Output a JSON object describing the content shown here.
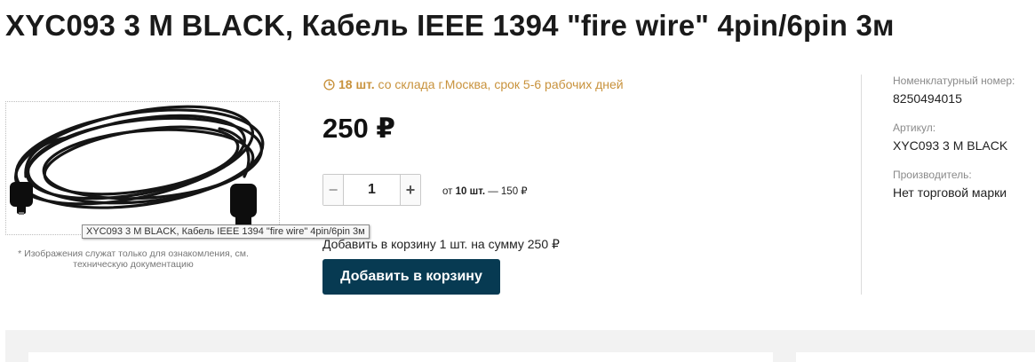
{
  "product": {
    "title": "XYC093 3 M BLACK, Кабель IEEE 1394 \"fire wire\" 4pin/6pin 3м",
    "image_tooltip": "XYC093 3 M BLACK, Кабель IEEE 1394 \"fire wire\" 4pin/6pin 3м",
    "image_note": "* Изображения служат только для ознакомления, см. техническую документацию"
  },
  "stock": {
    "icon": "clock-icon",
    "count": "18 шт.",
    "text": "со склада г.Москва, срок 5-6 рабочих дней",
    "color": "#c8923c"
  },
  "price": {
    "value": "250 ₽"
  },
  "quantity": {
    "value": "1",
    "minus_label": "−",
    "plus_label": "+"
  },
  "bulk": {
    "prefix": "от",
    "qty": "10 шт.",
    "suffix": "— 150 ₽"
  },
  "cart": {
    "summary": "Добавить в корзину 1 шт. на сумму 250 ₽",
    "button_label": "Добавить в корзину",
    "button_color": "#073a52"
  },
  "properties": [
    {
      "label": "Номенклатурный номер:",
      "value": "8250494015"
    },
    {
      "label": "Артикул:",
      "value": "XYC093 3 M BLACK"
    },
    {
      "label": "Производитель:",
      "value": "Нет торговой марки"
    }
  ]
}
